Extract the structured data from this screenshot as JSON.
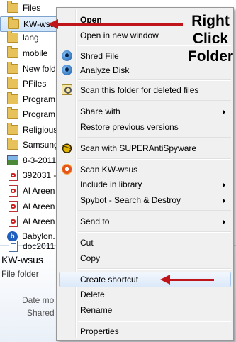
{
  "file_list": [
    {
      "name": "Files",
      "icon": "folder-icon"
    },
    {
      "name": "KW-wsus",
      "icon": "folder-icon",
      "selected": true
    },
    {
      "name": "lang",
      "icon": "folder-icon"
    },
    {
      "name": "mobile",
      "icon": "folder-icon"
    },
    {
      "name": "New folder",
      "icon": "folder-icon"
    },
    {
      "name": "PFiles",
      "icon": "folder-icon"
    },
    {
      "name": "Program",
      "icon": "folder-icon"
    },
    {
      "name": "Program",
      "icon": "folder-icon"
    },
    {
      "name": "Religious",
      "icon": "folder-icon"
    },
    {
      "name": "Samsung",
      "icon": "folder-icon"
    },
    {
      "name": "8-3-2011",
      "icon": "image-icon"
    },
    {
      "name": "392031 -",
      "icon": "pdf-icon"
    },
    {
      "name": "Al Areen",
      "icon": "pdf-icon"
    },
    {
      "name": "Al Areen",
      "icon": "pdf-icon"
    },
    {
      "name": "Al Areen",
      "icon": "pdf-icon"
    },
    {
      "name": "Babylon.",
      "icon": "babylon-icon"
    },
    {
      "name": "doc2011",
      "icon": "doc-icon"
    }
  ],
  "details": {
    "name": "KW-wsus",
    "type": "File folder",
    "date_label": "Date mo",
    "shared_label": "Shared"
  },
  "context_menu": {
    "open": "Open",
    "open_new_window": "Open in new window",
    "shred_file": "Shred File",
    "analyze_disk": "Analyze Disk",
    "scan_deleted": "Scan this folder for deleted files",
    "share_with": "Share with",
    "restore_previous": "Restore previous versions",
    "scan_superantispyware": "Scan with SUPERAntiSpyware",
    "scan_kw": "Scan KW-wsus",
    "include_library": "Include in library",
    "spybot": "Spybot - Search & Destroy",
    "send_to": "Send to",
    "cut": "Cut",
    "copy": "Copy",
    "create_shortcut": "Create shortcut",
    "delete": "Delete",
    "rename": "Rename",
    "properties": "Properties"
  },
  "annotation": {
    "line1": "Right",
    "line2": "Click",
    "line3": "Folder"
  },
  "colors": {
    "arrow": "#c0141b",
    "selection_border": "#7da2ce",
    "menu_background": "#f0f0f0"
  }
}
